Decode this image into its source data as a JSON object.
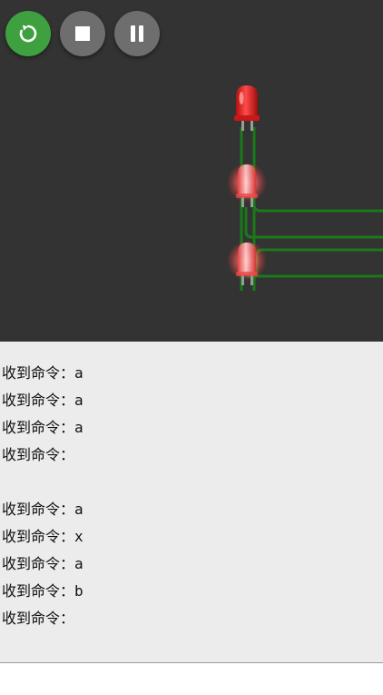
{
  "controls": [
    {
      "id": "restart",
      "icon": "restart-icon",
      "color": "#3fa040"
    },
    {
      "id": "stop",
      "icon": "stop-icon",
      "color": "#6e6e6e"
    },
    {
      "id": "pause",
      "icon": "pause-icon",
      "color": "#6e6e6e"
    }
  ],
  "canvas": {
    "background": "#333333",
    "wire_color": "#1a7a1a",
    "leds": [
      {
        "name": "led-1",
        "color": "#e02020",
        "state": "off"
      },
      {
        "name": "led-2",
        "color": "#e02020",
        "state": "on"
      },
      {
        "name": "led-3",
        "color": "#e02020",
        "state": "on"
      }
    ]
  },
  "serial_output": {
    "lines": [
      "收到命令：a",
      "收到命令：a",
      "收到命令：a",
      "收到命令：",
      "",
      "收到命令：a",
      "收到命令：x",
      "收到命令：a",
      "收到命令：b",
      "收到命令："
    ]
  }
}
